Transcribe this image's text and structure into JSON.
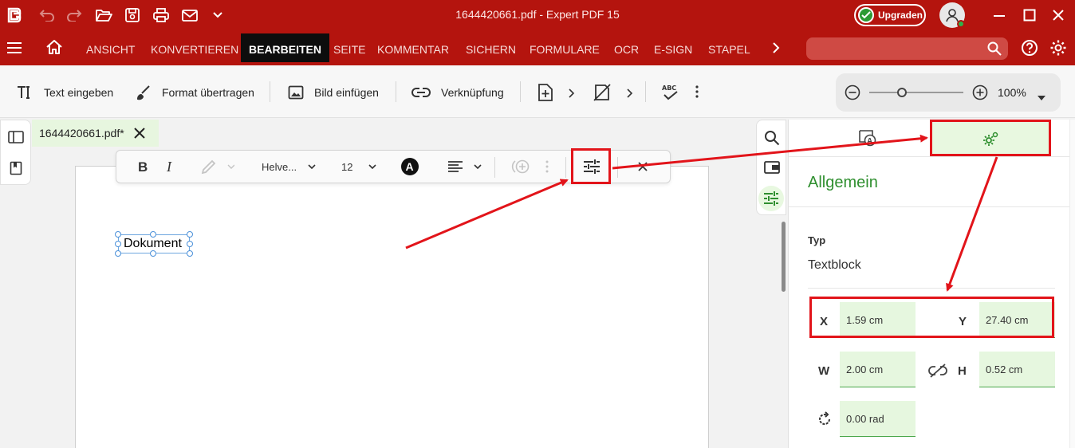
{
  "titlebar": {
    "title": "1644420661.pdf   -   Expert PDF 15",
    "upgrade_label": "Upgraden",
    "quick_access_icons": [
      "app-logo-icon",
      "undo-icon",
      "redo-icon",
      "open-folder-icon",
      "save-icon",
      "print-icon",
      "mail-icon",
      "chevron-down-icon"
    ]
  },
  "menu": {
    "tabs": [
      "ANSICHT",
      "KONVERTIEREN",
      "BEARBEITEN",
      "SEITE",
      "KOMMENTAR",
      "SICHERN",
      "FORMULARE",
      "OCR",
      "E-SIGN",
      "STAPEL"
    ],
    "active": "BEARBEITEN"
  },
  "ribbon": {
    "text_input": "Text eingeben",
    "format_transfer": "Format übertragen",
    "insert_image": "Bild einfügen",
    "link": "Verknüpfung",
    "zoom_value": "100%",
    "zoom_level": 0.35
  },
  "document": {
    "tab_label": "1644420661.pdf*",
    "text_block": "Dokument"
  },
  "format_toolbar": {
    "font": "Helve...",
    "size": "12"
  },
  "properties": {
    "section_title": "Allgemein",
    "type_label": "Typ",
    "type_value": "Textblock",
    "x_label": "X",
    "x_value": "1.59 cm",
    "y_label": "Y",
    "y_value": "27.40 cm",
    "w_label": "W",
    "w_value": "2.00 cm",
    "h_label": "H",
    "h_value": "0.52 cm",
    "rotation_value": "0.00 rad"
  },
  "colors": {
    "brand_red": "#b4140e",
    "accent_green": "#2f8f2f",
    "annotation_red": "#e2141a"
  }
}
